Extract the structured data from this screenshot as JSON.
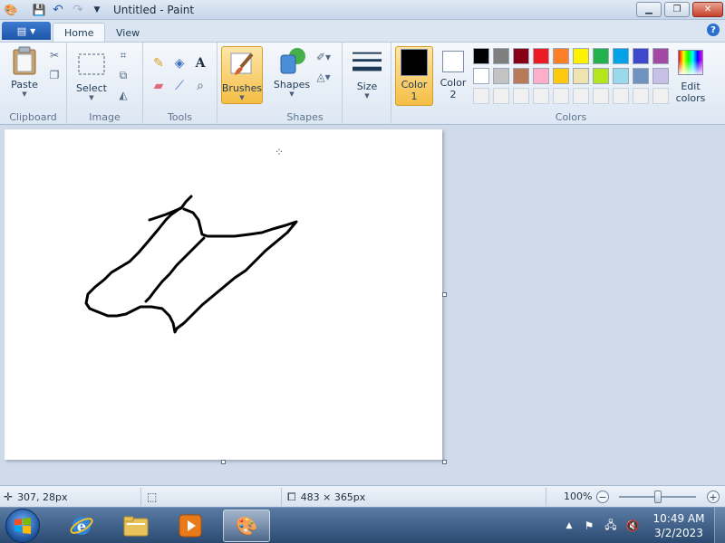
{
  "window": {
    "title": "Untitled - Paint"
  },
  "tabs": {
    "file_icon": "paint-menu-icon",
    "home": "Home",
    "view": "View"
  },
  "ribbon": {
    "clipboard": {
      "paste": "Paste",
      "label": "Clipboard"
    },
    "image": {
      "select": "Select",
      "label": "Image"
    },
    "tools": {
      "label": "Tools"
    },
    "brushes": "Brushes",
    "shapes": {
      "button": "Shapes",
      "label": "Shapes"
    },
    "size": "Size",
    "color1": {
      "line1": "Color",
      "line2": "1",
      "value": "#000000"
    },
    "color2": {
      "line1": "Color",
      "line2": "2",
      "value": "#ffffff"
    },
    "colors": {
      "label": "Colors"
    },
    "edit_colors": {
      "line1": "Edit",
      "line2": "colors"
    }
  },
  "palette": {
    "row1": [
      "#000000",
      "#7f7f7f",
      "#880015",
      "#ed1c24",
      "#ff7f27",
      "#fff200",
      "#22b14c",
      "#00a2e8",
      "#3f48cc",
      "#a349a4"
    ],
    "row2": [
      "#ffffff",
      "#c3c3c3",
      "#b97a57",
      "#ffaec9",
      "#ffc90e",
      "#efe4b0",
      "#b5e61d",
      "#99d9ea",
      "#7092be",
      "#c8bfe7"
    ],
    "row3": [
      "#f0f0f0",
      "#f0f0f0",
      "#f0f0f0",
      "#f0f0f0",
      "#f0f0f0",
      "#f0f0f0",
      "#f0f0f0",
      "#f0f0f0",
      "#f0f0f0",
      "#f0f0f0"
    ]
  },
  "status": {
    "cursor_pos": "307, 28px",
    "canvas_size": "483 × 365px",
    "zoom": "100%"
  },
  "taskbar": {
    "time": "10:49 AM",
    "date": "3/2/2023"
  }
}
